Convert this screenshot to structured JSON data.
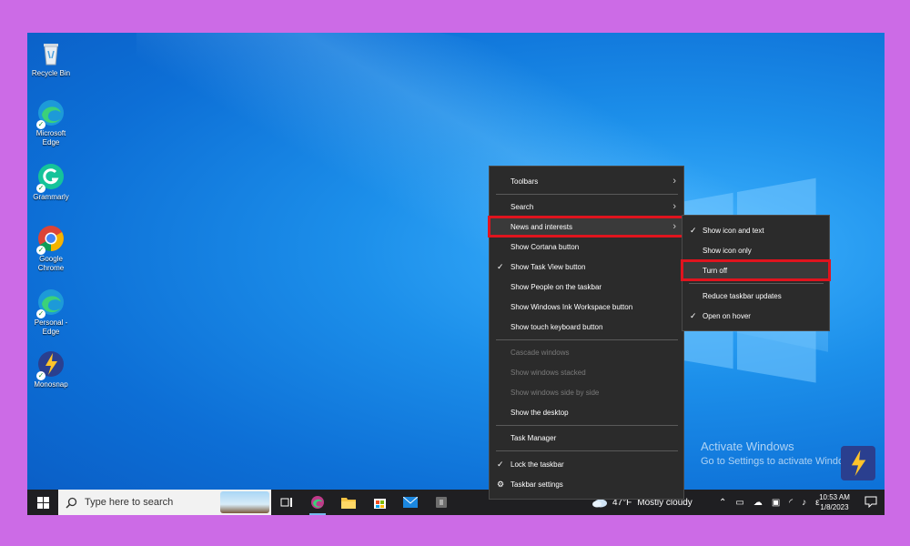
{
  "desktop": {
    "icons": [
      {
        "label": "Recycle Bin"
      },
      {
        "label": "Microsoft Edge"
      },
      {
        "label": "Grammarly"
      },
      {
        "label": "Google Chrome"
      },
      {
        "label": "Personal - Edge"
      },
      {
        "label": "Monosnap"
      }
    ],
    "activate": {
      "title": "Activate Windows",
      "subtitle": "Go to Settings to activate Windows."
    }
  },
  "taskbar": {
    "search_placeholder": "Type here to search",
    "weather": {
      "temp": "47°F",
      "condition": "Mostly cloudy"
    },
    "clock": {
      "time": "10:53 AM",
      "date": "1/8/2023"
    },
    "lang": "ε"
  },
  "context_menu": {
    "items": [
      {
        "label": "Toolbars",
        "arrow": "›"
      },
      {
        "label": "Search",
        "arrow": "›"
      },
      {
        "label": "News and interests",
        "arrow": "›",
        "highlighted": true
      },
      {
        "label": "Show Cortana button"
      },
      {
        "label": "Show Task View button",
        "checked": "✓"
      },
      {
        "label": "Show People on the taskbar"
      },
      {
        "label": "Show Windows Ink Workspace button"
      },
      {
        "label": "Show touch keyboard button"
      },
      {
        "label": "Cascade windows",
        "disabled": true
      },
      {
        "label": "Show windows stacked",
        "disabled": true
      },
      {
        "label": "Show windows side by side",
        "disabled": true
      },
      {
        "label": "Show the desktop"
      },
      {
        "label": "Task Manager"
      },
      {
        "label": "Lock the taskbar",
        "checked": "✓"
      },
      {
        "label": "Taskbar settings",
        "icon": "gear-icon"
      }
    ]
  },
  "submenu": {
    "items": [
      {
        "label": "Show icon and text",
        "checked": "✓"
      },
      {
        "label": "Show icon only"
      },
      {
        "label": "Turn off",
        "highlighted": true
      },
      {
        "label": "Reduce taskbar updates"
      },
      {
        "label": "Open on hover",
        "checked": "✓"
      }
    ]
  },
  "colors": {
    "highlight": "#e0141e",
    "menu_bg": "#2b2b2b",
    "taskbar_bg": "#1f1f22",
    "page_bg": "#cc6be6"
  }
}
